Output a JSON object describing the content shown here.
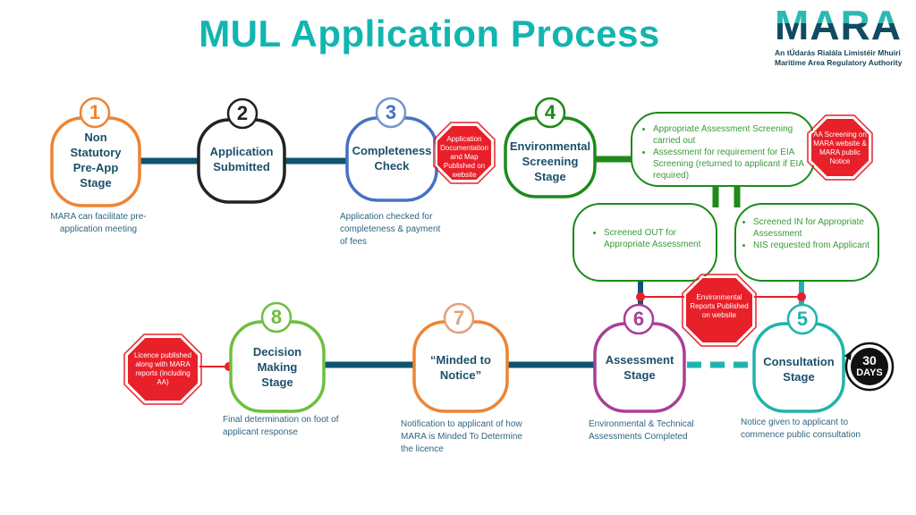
{
  "title": "MUL Application Process",
  "logo": {
    "word": "MARA",
    "line1": "An tÚdarás Rialála Limistéir Mhuirí",
    "line2": "Maritime Area Regulatory Authority"
  },
  "colors": {
    "title": "#12b5b0",
    "connector": "#0f5470",
    "notice_red": "#e8202a",
    "screening_green": "#1e8a1a",
    "bullet_text": "#3c9a3a",
    "stage_text": "#1b506a"
  },
  "stages": [
    {
      "number": "1",
      "label": "Non Statutory Pre-App Stage",
      "lines": [
        "Non",
        "Statutory",
        "Pre-App",
        "Stage"
      ],
      "description": "MARA  can facilitate pre-application meeting",
      "color": "#ef8432"
    },
    {
      "number": "2",
      "label": "Application Submitted",
      "lines": [
        "Application",
        "Submitted"
      ],
      "description": "",
      "color": "#222222"
    },
    {
      "number": "3",
      "label": "Completeness Check",
      "lines": [
        "Completeness",
        "Check"
      ],
      "description": "Application checked for completeness & payment of fees",
      "color": "#4472c4"
    },
    {
      "number": "4",
      "label": "Environmental Screening Stage",
      "lines": [
        "Environmental",
        "Screening",
        "Stage"
      ],
      "description": "",
      "color": "#1e8a1a"
    },
    {
      "number": "5",
      "label": "Consultation Stage",
      "lines": [
        "Consultation",
        "Stage"
      ],
      "description": "Notice given to applicant to commence public consultation",
      "color": "#1fb3ad"
    },
    {
      "number": "6",
      "label": "Assessment Stage",
      "lines": [
        "Assessment",
        "Stage"
      ],
      "description": "Environmental & Technical Assessments Completed",
      "color": "#a83f97"
    },
    {
      "number": "7",
      "label": "“Minded to Notice”",
      "lines": [
        "“Minded to",
        "Notice”"
      ],
      "description": "Notification to applicant of how MARA  is Minded To Determine the licence",
      "color": "#ef8432"
    },
    {
      "number": "8",
      "label": "Decision Making Stage",
      "lines": [
        "Decision",
        "Making",
        "Stage"
      ],
      "description": "Final determination on foot of applicant response",
      "color": "#6cbf3f"
    }
  ],
  "screening_boxes": {
    "main": [
      "Appropriate Assessment Screening carried out",
      "Assessment for requirement for EIA Screening (returned to applicant if EIA required)"
    ],
    "screened_out": [
      "Screened OUT for Appropriate Assessment"
    ],
    "screened_in": [
      "Screened IN for Appropriate Assessment",
      "NIS requested from Applicant"
    ]
  },
  "notices": [
    {
      "id": "app-docs",
      "text": "Application Documentation and Map Published on website"
    },
    {
      "id": "aa-screening",
      "text": "AA Screening  on MARA website & MARA public Notice"
    },
    {
      "id": "env-reports",
      "text": "Environmental Reports Published on website"
    },
    {
      "id": "licence",
      "text": "Licence published along with MARA reports (including AA)"
    }
  ],
  "timer_badge": {
    "value": "30",
    "unit": "DAYS"
  }
}
